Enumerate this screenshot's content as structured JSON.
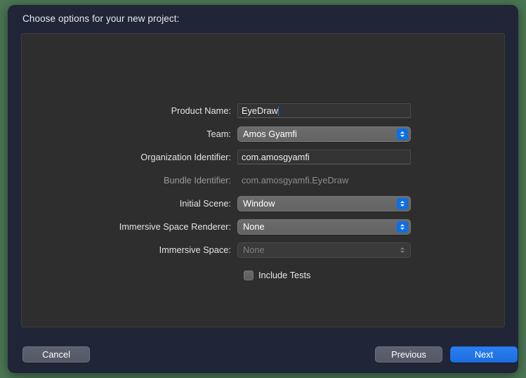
{
  "window": {
    "title": "Choose options for your new project:",
    "background_color": "#4a7553",
    "dialog_color": "#212538",
    "panel_color": "#2e2e2e",
    "accent_color": "#0a6fe8"
  },
  "form": {
    "rows": [
      {
        "label": "Product Name:",
        "type": "textfield",
        "value": "EyeDraw",
        "enabled": true,
        "focused": true
      },
      {
        "label": "Team:",
        "type": "popup",
        "value": "Amos Gyamfi",
        "enabled": true,
        "focused": false
      },
      {
        "label": "Organization Identifier:",
        "type": "textfield",
        "value": "com.amosgyamfi",
        "enabled": true,
        "focused": false
      },
      {
        "label": "Bundle Identifier:",
        "type": "static",
        "value": "com.amosgyamfi.EyeDraw",
        "enabled": false,
        "focused": false
      },
      {
        "label": "Initial Scene:",
        "type": "popup",
        "value": "Window",
        "enabled": true,
        "focused": false
      },
      {
        "label": "Immersive Space Renderer:",
        "type": "popup",
        "value": "None",
        "enabled": true,
        "focused": false
      },
      {
        "label": "Immersive Space:",
        "type": "popup",
        "value": "None",
        "enabled": false,
        "focused": false
      }
    ],
    "checkbox": {
      "label": "Include Tests",
      "checked": false
    }
  },
  "footer": {
    "cancel_label": "Cancel",
    "previous_label": "Previous",
    "next_label": "Next"
  },
  "icons": {
    "popup_arrows": "chevron-up-down-icon",
    "checkbox": "checkbox-icon",
    "text_caret": "text-caret"
  }
}
